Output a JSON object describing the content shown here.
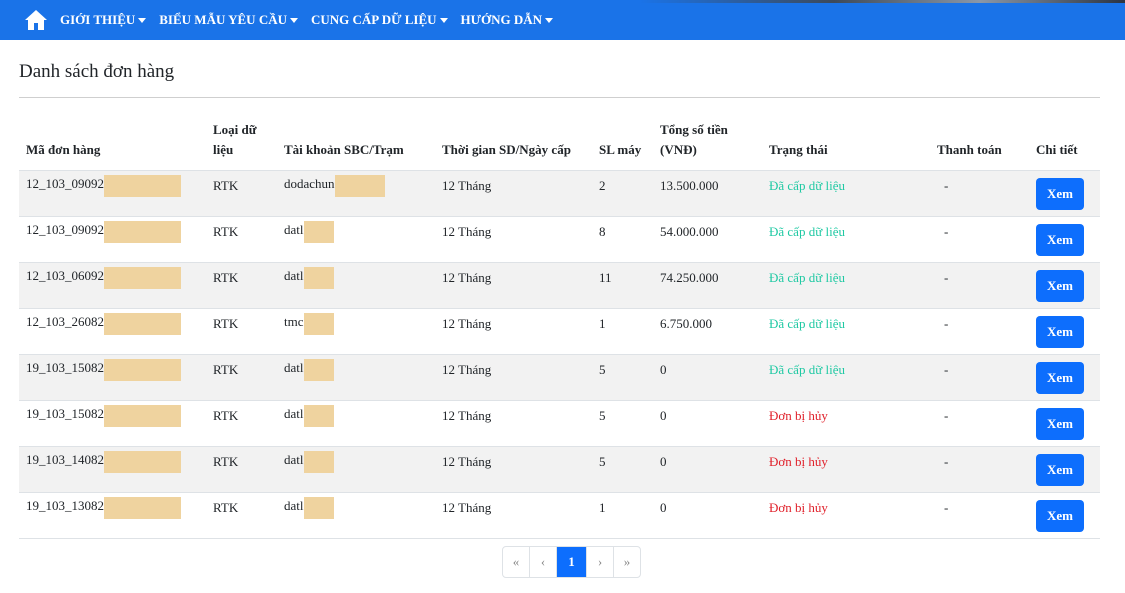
{
  "nav": {
    "items": [
      {
        "label": "GIỚI THIỆU"
      },
      {
        "label": "BIỂU MẪU YÊU CẦU"
      },
      {
        "label": "CUNG CẤP DỮ LIỆU"
      },
      {
        "label": "HƯỚNG DẪN"
      }
    ]
  },
  "page": {
    "title": "Danh sách đơn hàng"
  },
  "table": {
    "headers": [
      "Mã đơn hàng",
      "Loại dữ liệu",
      "Tài khoản SBC/Trạm",
      "Thời gian SD/Ngày cấp",
      "SL máy",
      "Tổng số tiền (VNĐ)",
      "Trạng thái",
      "Thanh toán",
      "Chi tiết"
    ],
    "rows": [
      {
        "code": "12_103_09092",
        "type": "RTK",
        "account": "dodachun",
        "duration": "12 Tháng",
        "qty": "2",
        "total": "13.500.000",
        "status": "Đã cấp dữ liệu",
        "payment": "-",
        "detail": "Xem"
      },
      {
        "code": "12_103_09092",
        "type": "RTK",
        "account": "datl",
        "duration": "12 Tháng",
        "qty": "8",
        "total": "54.000.000",
        "status": "Đã cấp dữ liệu",
        "payment": "-",
        "detail": "Xem"
      },
      {
        "code": "12_103_06092",
        "type": "RTK",
        "account": "datl",
        "duration": "12 Tháng",
        "qty": "11",
        "total": "74.250.000",
        "status": "Đã cấp dữ liệu",
        "payment": "-",
        "detail": "Xem"
      },
      {
        "code": "12_103_26082",
        "type": "RTK",
        "account": "tmc",
        "duration": "12 Tháng",
        "qty": "1",
        "total": "6.750.000",
        "status": "Đã cấp dữ liệu",
        "payment": "-",
        "detail": "Xem"
      },
      {
        "code": "19_103_15082",
        "type": "RTK",
        "account": "datl",
        "duration": "12 Tháng",
        "qty": "5",
        "total": "0",
        "status": "Đã cấp dữ liệu",
        "payment": "-",
        "detail": "Xem"
      },
      {
        "code": "19_103_15082",
        "type": "RTK",
        "account": "datl",
        "duration": "12 Tháng",
        "qty": "5",
        "total": "0",
        "status": "Đơn bị hủy",
        "payment": "-",
        "detail": "Xem"
      },
      {
        "code": "19_103_14082",
        "type": "RTK",
        "account": "datl",
        "duration": "12 Tháng",
        "qty": "5",
        "total": "0",
        "status": "Đơn bị hủy",
        "payment": "-",
        "detail": "Xem"
      },
      {
        "code": "19_103_13082",
        "type": "RTK",
        "account": "datl",
        "duration": "12 Tháng",
        "qty": "1",
        "total": "0",
        "status": "Đơn bị hủy",
        "payment": "-",
        "detail": "Xem"
      }
    ]
  },
  "pagination": {
    "first": "«",
    "prev": "‹",
    "current": "1",
    "next": "›",
    "last": "»"
  },
  "colors": {
    "navbar": "#1a73e8",
    "accent": "#0d6efd",
    "status_ok": "#1fc9a3",
    "status_cancel": "#e0202a"
  }
}
